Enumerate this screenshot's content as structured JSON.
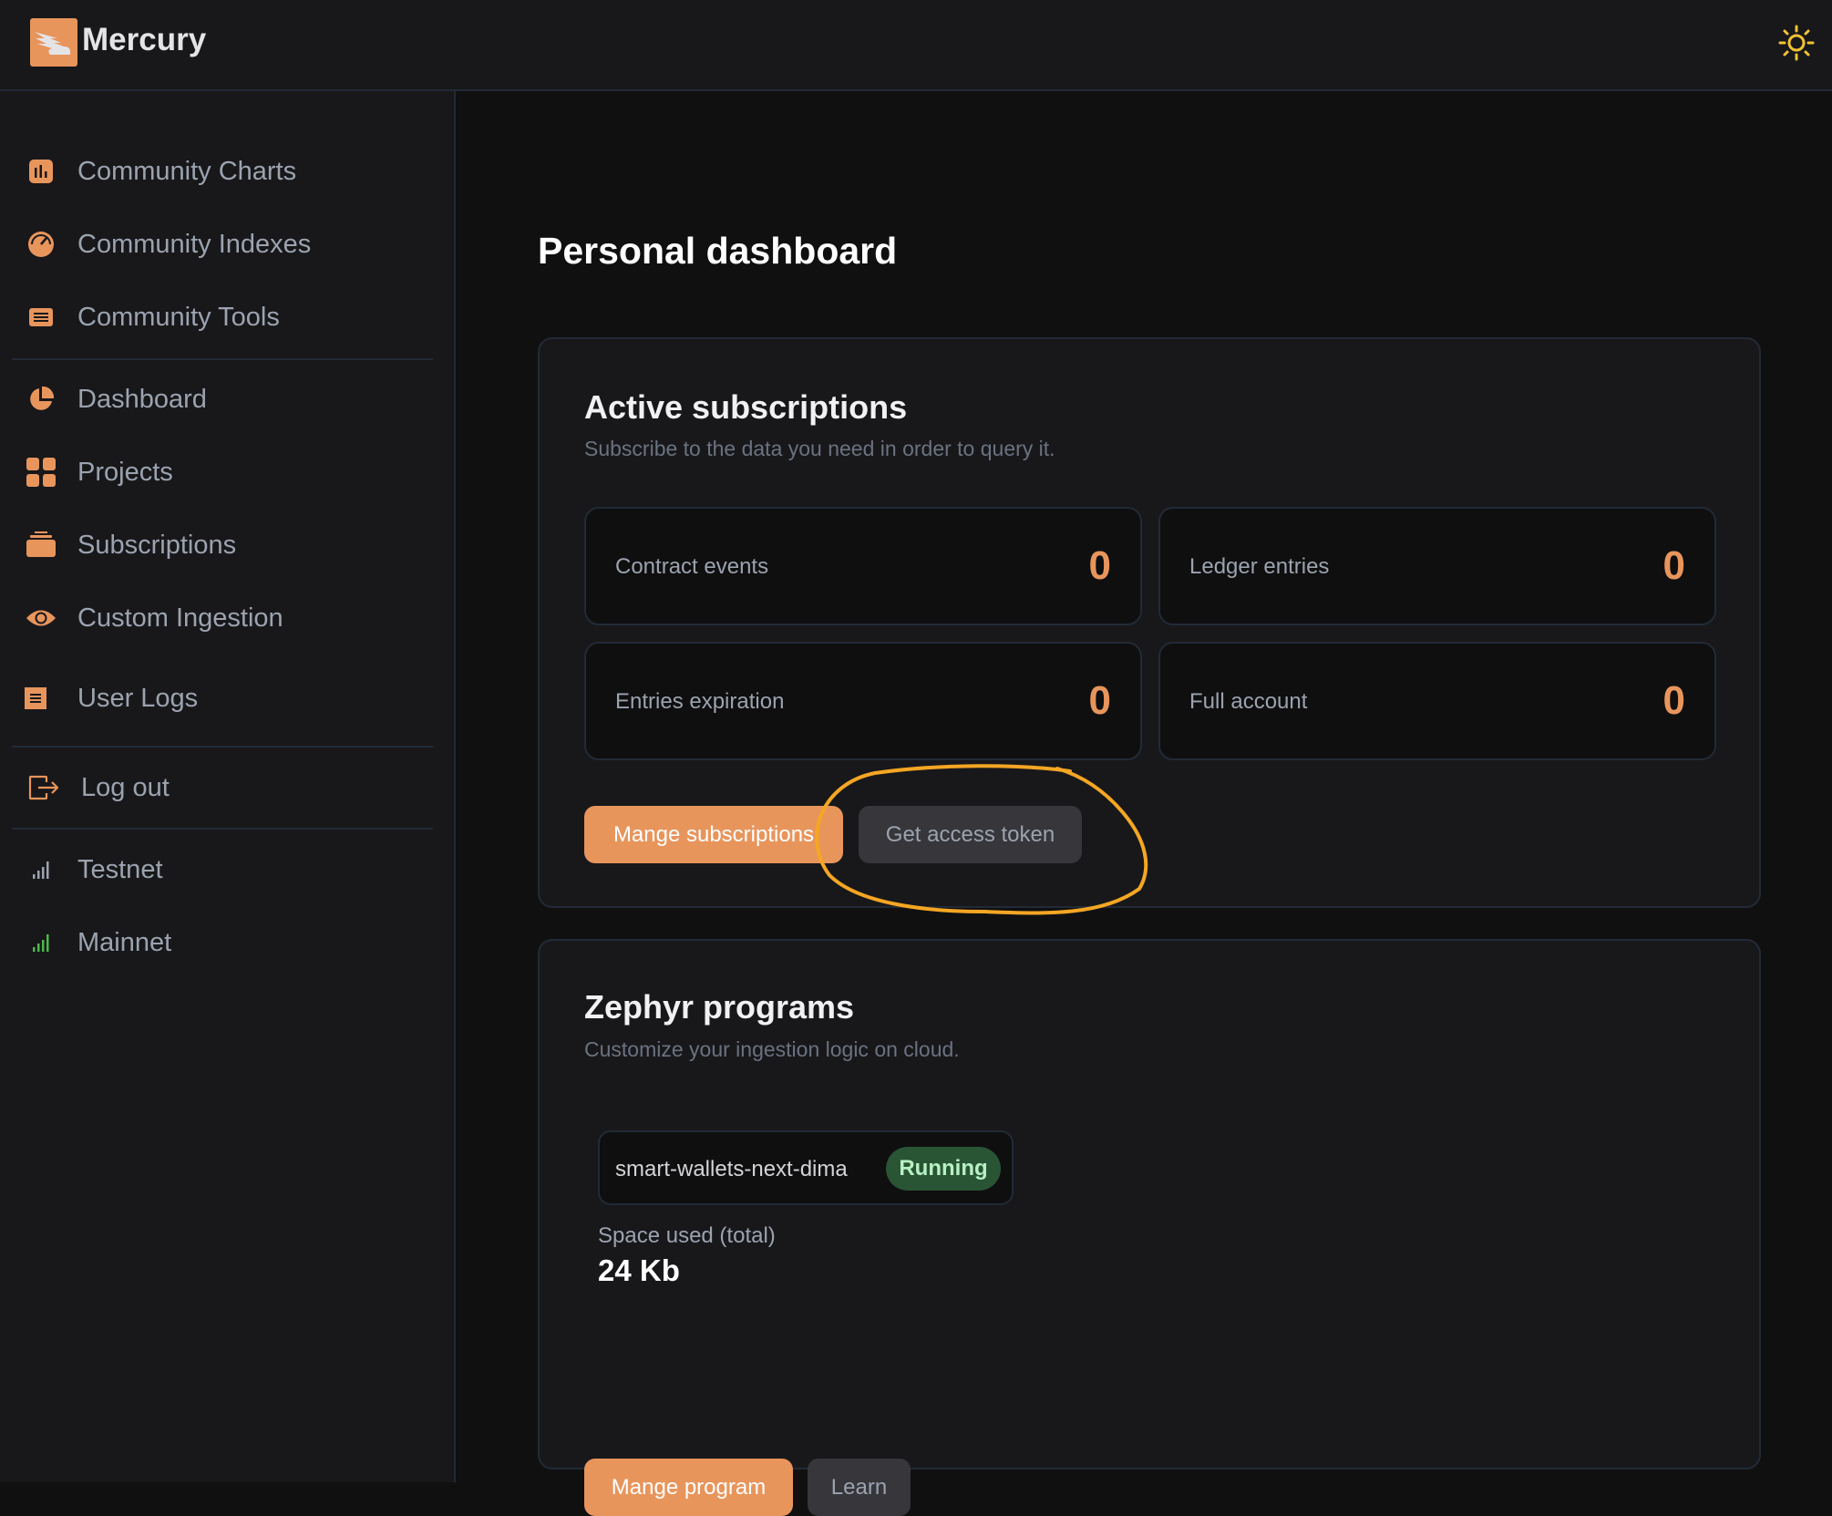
{
  "header": {
    "brand": "Mercury",
    "logo_icon": "winged-logo-icon",
    "theme_toggle_icon": "sun-icon"
  },
  "sidebar": {
    "items": [
      {
        "label": "Community Charts",
        "icon": "bar-chart-icon"
      },
      {
        "label": "Community Indexes",
        "icon": "gauge-icon"
      },
      {
        "label": "Community Tools",
        "icon": "list-box-icon"
      },
      {
        "label": "Dashboard",
        "icon": "pie-chart-icon"
      },
      {
        "label": "Projects",
        "icon": "grid-icon"
      },
      {
        "label": "Subscriptions",
        "icon": "stack-icon"
      },
      {
        "label": "Custom Ingestion",
        "icon": "eye-icon"
      },
      {
        "label": "User Logs",
        "icon": "document-icon"
      },
      {
        "label": "Log out",
        "icon": "logout-icon"
      },
      {
        "label": "Testnet",
        "icon": "signal-icon"
      },
      {
        "label": "Mainnet",
        "icon": "signal-icon"
      }
    ],
    "network_colors": {
      "testnet": "#9ca3af",
      "mainnet": "#4cb84a"
    }
  },
  "main": {
    "page_title": "Personal dashboard",
    "subscriptions": {
      "title": "Active subscriptions",
      "subtitle": "Subscribe to the data you need in order to query it.",
      "stats": [
        {
          "label": "Contract events",
          "value": "0"
        },
        {
          "label": "Ledger entries",
          "value": "0"
        },
        {
          "label": "Entries expiration",
          "value": "0"
        },
        {
          "label": "Full account",
          "value": "0"
        }
      ],
      "manage_button": "Mange subscriptions",
      "token_button": "Get access token"
    },
    "zephyr": {
      "title": "Zephyr programs",
      "subtitle": "Customize your ingestion logic on cloud.",
      "program": {
        "name": "smart-wallets-next-dima",
        "status": "Running"
      },
      "space_label": "Space used (total)",
      "space_value": "24 Kb",
      "manage_button": "Mange program",
      "learn_button": "Learn"
    }
  },
  "colors": {
    "accent": "#e8955c",
    "annotation": "#f5a623",
    "status_running_bg": "#2a5535",
    "status_running_text": "#b7f1c3"
  }
}
